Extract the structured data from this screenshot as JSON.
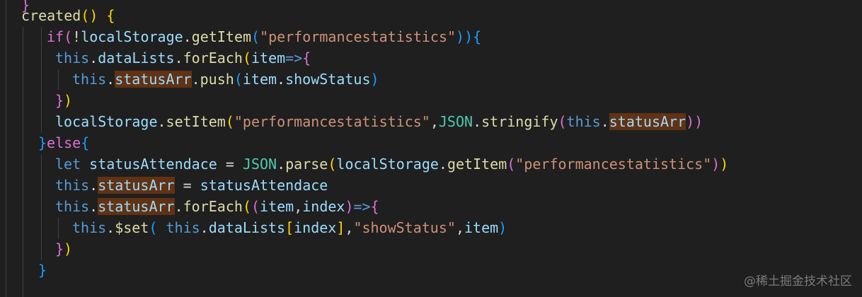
{
  "lines": [
    {
      "tokens": [
        {
          "t": "}",
          "c": "p2"
        }
      ]
    },
    {
      "tokens": [
        {
          "t": "created",
          "c": "fn"
        },
        {
          "t": "() ",
          "c": "p1"
        },
        {
          "t": "{",
          "c": "p1"
        }
      ]
    },
    {
      "tokens": [
        {
          "t": "if",
          "c": "p2"
        },
        {
          "t": "(",
          "c": "p2"
        },
        {
          "t": "!",
          "c": "op"
        },
        {
          "t": "localStorage",
          "c": "var"
        },
        {
          "t": ".",
          "c": "op"
        },
        {
          "t": "getItem",
          "c": "fn"
        },
        {
          "t": "(",
          "c": "p3"
        },
        {
          "t": "\"performancestatistics\"",
          "c": "str"
        },
        {
          "t": "))",
          "c": "p3"
        },
        {
          "t": "{",
          "c": "p3"
        }
      ]
    },
    {
      "tokens": [
        {
          "t": "this",
          "c": "kw"
        },
        {
          "t": ".",
          "c": "op"
        },
        {
          "t": "dataLists",
          "c": "var"
        },
        {
          "t": ".",
          "c": "op"
        },
        {
          "t": "forEach",
          "c": "fn"
        },
        {
          "t": "(",
          "c": "p1"
        },
        {
          "t": "item",
          "c": "var"
        },
        {
          "t": "=>",
          "c": "kw"
        },
        {
          "t": "{",
          "c": "p2"
        }
      ]
    },
    {
      "tokens": [
        {
          "t": "this",
          "c": "kw"
        },
        {
          "t": ".",
          "c": "op"
        },
        {
          "t": "statusArr",
          "c": "var hl"
        },
        {
          "t": ".",
          "c": "op"
        },
        {
          "t": "push",
          "c": "fn"
        },
        {
          "t": "(",
          "c": "p3"
        },
        {
          "t": "item",
          "c": "var"
        },
        {
          "t": ".",
          "c": "op"
        },
        {
          "t": "showStatus",
          "c": "var"
        },
        {
          "t": ")",
          "c": "p3"
        }
      ]
    },
    {
      "tokens": [
        {
          "t": "}",
          "c": "p2"
        },
        {
          "t": ")",
          "c": "p1"
        }
      ]
    },
    {
      "tokens": [
        {
          "t": "localStorage",
          "c": "var"
        },
        {
          "t": ".",
          "c": "op"
        },
        {
          "t": "setItem",
          "c": "fn"
        },
        {
          "t": "(",
          "c": "p1"
        },
        {
          "t": "\"performancestatistics\"",
          "c": "str"
        },
        {
          "t": ",",
          "c": "op"
        },
        {
          "t": "JSON",
          "c": "cls"
        },
        {
          "t": ".",
          "c": "op"
        },
        {
          "t": "stringify",
          "c": "fn"
        },
        {
          "t": "(",
          "c": "p2"
        },
        {
          "t": "this",
          "c": "kw"
        },
        {
          "t": ".",
          "c": "op"
        },
        {
          "t": "statusArr",
          "c": "var hl"
        },
        {
          "t": "))",
          "c": "p2"
        }
      ]
    },
    {
      "tokens": [
        {
          "t": "}",
          "c": "p3"
        },
        {
          "t": "else",
          "c": "p2"
        },
        {
          "t": "{",
          "c": "p3"
        }
      ]
    },
    {
      "tokens": [
        {
          "t": "let",
          "c": "kw"
        },
        {
          "t": " ",
          "c": "op"
        },
        {
          "t": "statusAttendace",
          "c": "var"
        },
        {
          "t": " = ",
          "c": "op"
        },
        {
          "t": "JSON",
          "c": "cls"
        },
        {
          "t": ".",
          "c": "op"
        },
        {
          "t": "parse",
          "c": "fn"
        },
        {
          "t": "(",
          "c": "p1"
        },
        {
          "t": "localStorage",
          "c": "var"
        },
        {
          "t": ".",
          "c": "op"
        },
        {
          "t": "getItem",
          "c": "fn"
        },
        {
          "t": "(",
          "c": "p2"
        },
        {
          "t": "\"performancestatistics\"",
          "c": "str"
        },
        {
          "t": ")",
          "c": "p2"
        },
        {
          "t": ")",
          "c": "p1"
        }
      ]
    },
    {
      "tokens": [
        {
          "t": "this",
          "c": "kw"
        },
        {
          "t": ".",
          "c": "op"
        },
        {
          "t": "statusArr",
          "c": "var hl"
        },
        {
          "t": " = ",
          "c": "op"
        },
        {
          "t": "statusAttendace",
          "c": "var"
        }
      ]
    },
    {
      "tokens": [
        {
          "t": "this",
          "c": "kw"
        },
        {
          "t": ".",
          "c": "op"
        },
        {
          "t": "statusArr",
          "c": "var hl"
        },
        {
          "t": ".",
          "c": "op"
        },
        {
          "t": "forEach",
          "c": "fn"
        },
        {
          "t": "(",
          "c": "p1"
        },
        {
          "t": "(",
          "c": "p2"
        },
        {
          "t": "item",
          "c": "var"
        },
        {
          "t": ",",
          "c": "op"
        },
        {
          "t": "index",
          "c": "var"
        },
        {
          "t": ")",
          "c": "p2"
        },
        {
          "t": "=>",
          "c": "kw"
        },
        {
          "t": "{",
          "c": "p2"
        }
      ]
    },
    {
      "tokens": [
        {
          "t": "this",
          "c": "kw"
        },
        {
          "t": ".",
          "c": "op"
        },
        {
          "t": "$set",
          "c": "fn"
        },
        {
          "t": "(",
          "c": "p3"
        },
        {
          "t": " ",
          "c": "op"
        },
        {
          "t": "this",
          "c": "kw"
        },
        {
          "t": ".",
          "c": "op"
        },
        {
          "t": "dataLists",
          "c": "var"
        },
        {
          "t": "[",
          "c": "p1"
        },
        {
          "t": "index",
          "c": "var"
        },
        {
          "t": "]",
          "c": "p1"
        },
        {
          "t": ",",
          "c": "op"
        },
        {
          "t": "\"showStatus\"",
          "c": "str"
        },
        {
          "t": ",",
          "c": "op"
        },
        {
          "t": "item",
          "c": "var"
        },
        {
          "t": ")",
          "c": "p3"
        }
      ]
    },
    {
      "tokens": [
        {
          "t": "}",
          "c": "p2"
        },
        {
          "t": ")",
          "c": "p1"
        }
      ]
    },
    {
      "tokens": [
        {
          "t": "}",
          "c": "p3"
        }
      ]
    }
  ],
  "watermark": "@稀土掘金技术社区"
}
